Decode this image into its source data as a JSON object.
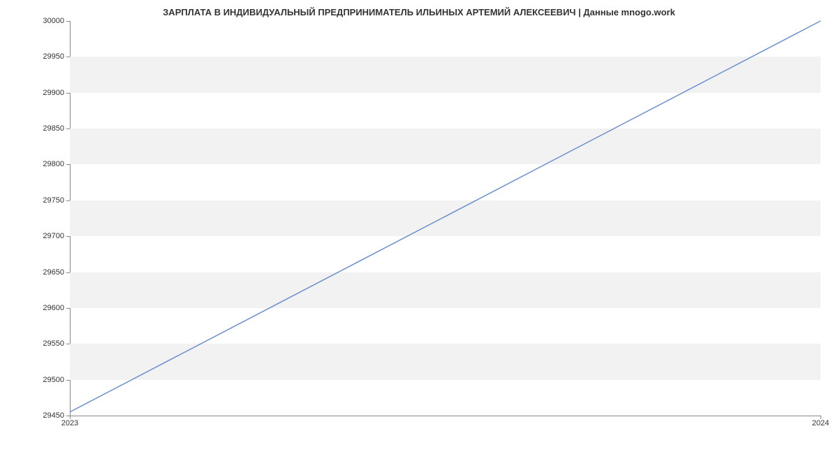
{
  "chart_data": {
    "type": "line",
    "title": "ЗАРПЛАТА В ИНДИВИДУАЛЬНЫЙ ПРЕДПРИНИМАТЕЛЬ ИЛЬИНЫХ АРТЕМИЙ АЛЕКСЕЕВИЧ | Данные mnogo.work",
    "x": [
      "2023",
      "2024"
    ],
    "values": [
      29455,
      30000
    ],
    "xlabel": "",
    "ylabel": "",
    "ylim": [
      29450,
      30000
    ],
    "y_ticks": [
      29450,
      29500,
      29550,
      29600,
      29650,
      29700,
      29750,
      29800,
      29850,
      29900,
      29950,
      30000
    ],
    "x_ticks": [
      "2023",
      "2024"
    ],
    "line_color": "#6b8fce"
  }
}
